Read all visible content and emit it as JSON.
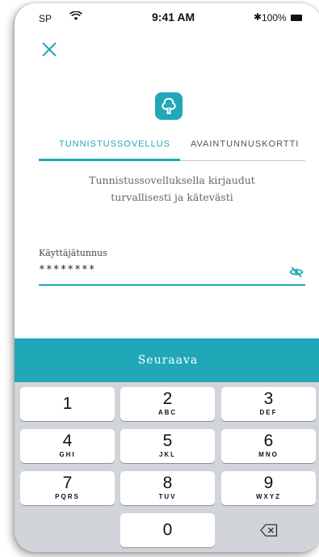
{
  "status_bar": {
    "carrier": "SP",
    "time": "9:41 AM",
    "battery": "100%"
  },
  "colors": {
    "accent": "#21a8b8"
  },
  "tabs": [
    {
      "label": "TUNNISTUSSOVELLUS",
      "active": true
    },
    {
      "label": "AVAINTUNNUSKORTTI",
      "active": false
    }
  ],
  "description": {
    "line1": "Tunnistussovelluksella kirjaudut",
    "line2": "turvallisesti ja kätevästi"
  },
  "username": {
    "label": "Käyttäjätunnus",
    "value": "********"
  },
  "next_button": "Seuraava",
  "keypad": {
    "keys": [
      {
        "num": "1",
        "letters": ""
      },
      {
        "num": "2",
        "letters": "ABC"
      },
      {
        "num": "3",
        "letters": "DEF"
      },
      {
        "num": "4",
        "letters": "GHI"
      },
      {
        "num": "5",
        "letters": "JKL"
      },
      {
        "num": "6",
        "letters": "MNO"
      },
      {
        "num": "7",
        "letters": "PQRS"
      },
      {
        "num": "8",
        "letters": "TUV"
      },
      {
        "num": "9",
        "letters": "WXYZ"
      },
      {
        "num": "0",
        "letters": ""
      }
    ]
  }
}
